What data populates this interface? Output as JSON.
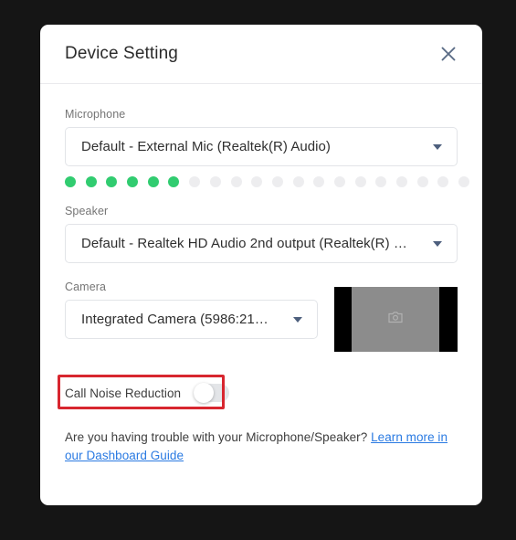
{
  "dialog": {
    "title": "Device Setting",
    "close_icon": "close-icon"
  },
  "microphone": {
    "label": "Microphone",
    "value": "Default - External Mic (Realtek(R) Audio)",
    "caret_icon": "chevron-down-icon",
    "level_meter": {
      "total_dots": 20,
      "active_dots": 6,
      "active_color": "#31cc70",
      "inactive_color": "#ededef"
    }
  },
  "speaker": {
    "label": "Speaker",
    "value": "Default - Realtek HD Audio 2nd output (Realtek(R) …",
    "caret_icon": "chevron-down-icon"
  },
  "camera": {
    "label": "Camera",
    "value": "Integrated Camera (5986:21…",
    "caret_icon": "chevron-down-icon",
    "preview": {
      "placeholder_icon": "broken-image-icon",
      "feed_color": "#8c8c8c",
      "letterbox_color": "#000000"
    }
  },
  "noise_reduction": {
    "label": "Call Noise Reduction",
    "toggle_state": "off",
    "toggle_icon": "toggle-switch-icon",
    "annotation_color": "#d8262f"
  },
  "footer": {
    "text": "Are you having trouble with your Microphone/Speaker? ",
    "link_text": "Learn more in our Dashboard Guide",
    "link_color": "#2a7ae2"
  }
}
